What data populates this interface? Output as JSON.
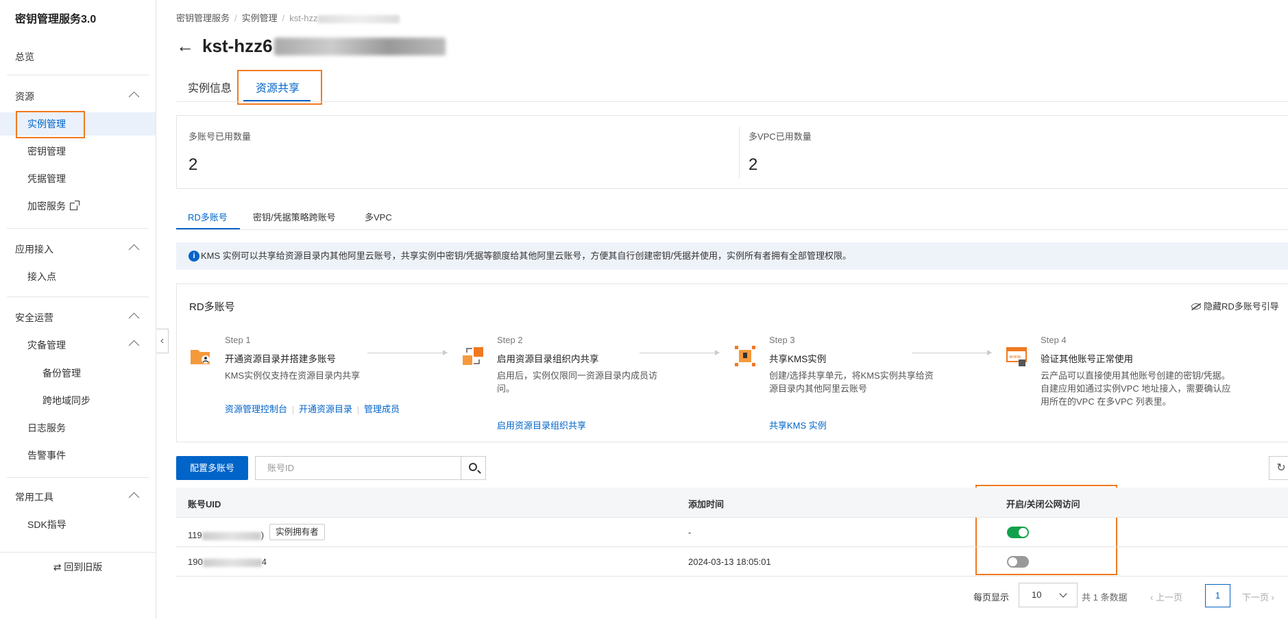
{
  "sidebar": {
    "title": "密钥管理服务3.0",
    "overview": "总览",
    "groups": {
      "resources": "资源",
      "app_access": "应用接入",
      "security_ops": "安全运营",
      "tools": "常用工具"
    },
    "items": {
      "instance_mgmt": "实例管理",
      "key_mgmt": "密钥管理",
      "credential_mgmt": "凭据管理",
      "crypto_service": "加密服务",
      "endpoint": "接入点",
      "dr_mgmt": "灾备管理",
      "backup_mgmt": "备份管理",
      "cross_region_sync": "跨地域同步",
      "log_service": "日志服务",
      "alert_events": "告警事件",
      "sdk_guide": "SDK指导"
    },
    "back_old": "⇄ 回到旧版"
  },
  "breadcrumb": {
    "items": [
      "密钥管理服务",
      "实例管理",
      "kst-hzz"
    ]
  },
  "page": {
    "title_prefix": "kst-hzz6"
  },
  "tabs": {
    "instance_info": "实例信息",
    "resource_share": "资源共享"
  },
  "stats": {
    "multi_account_label": "多账号已用数量",
    "multi_account_value": "2",
    "multi_vpc_label": "多VPC已用数量",
    "multi_vpc_value": "2"
  },
  "subtabs": {
    "rd_multi": "RD多账号",
    "policy_cross": "密钥/凭据策略跨账号",
    "multi_vpc": "多VPC"
  },
  "info": "KMS 实例可以共享给资源目录内其他阿里云账号，共享实例中密钥/凭据等额度给其他阿里云账号，方便其自行创建密钥/凭据并使用，实例所有者拥有全部管理权限。",
  "guide": {
    "title": "RD多账号",
    "hide": "隐藏RD多账号引导",
    "steps": [
      {
        "label": "Step 1",
        "title": "开通资源目录并搭建多账号",
        "desc": "KMS实例仅支持在资源目录内共享",
        "links": [
          "资源管理控制台",
          "开通资源目录",
          "管理成员"
        ]
      },
      {
        "label": "Step 2",
        "title": "启用资源目录组织内共享",
        "desc": "启用后，实例仅限同一资源目录内成员访问。",
        "links": [
          "启用资源目录组织共享"
        ]
      },
      {
        "label": "Step 3",
        "title": "共享KMS实例",
        "desc": "创建/选择共享单元，将KMS实例共享给资源目录内其他阿里云账号",
        "links": [
          "共享KMS 实例"
        ]
      },
      {
        "label": "Step 4",
        "title": "验证其他账号正常使用",
        "desc": "云产品可以直接使用其他账号创建的密钥/凭据。自建应用如通过实例VPC 地址接入，需要确认应用所在的VPC 在多VPC 列表里。",
        "links": []
      }
    ]
  },
  "toolbar": {
    "config_button": "配置多账号",
    "search_placeholder": "账号ID"
  },
  "table": {
    "headers": [
      "账号UID",
      "添加时间",
      "开启/关闭公网访问"
    ],
    "rows": [
      {
        "uid_prefix": "119",
        "uid_suffix": ")",
        "tag": "实例拥有者",
        "time": "-",
        "public_access": true
      },
      {
        "uid_prefix": "190",
        "uid_suffix": "4",
        "tag": "",
        "time": "2024-03-13 18:05:01",
        "public_access": false
      }
    ]
  },
  "pager": {
    "per_page_label": "每页显示",
    "per_page_value": "10",
    "total": "共 1 条数据",
    "prev": "上一页",
    "current": "1",
    "next": "下一页"
  },
  "colors": {
    "primary": "#0064c8",
    "highlight": "#f0791f",
    "toggle_on": "#12a14a"
  }
}
